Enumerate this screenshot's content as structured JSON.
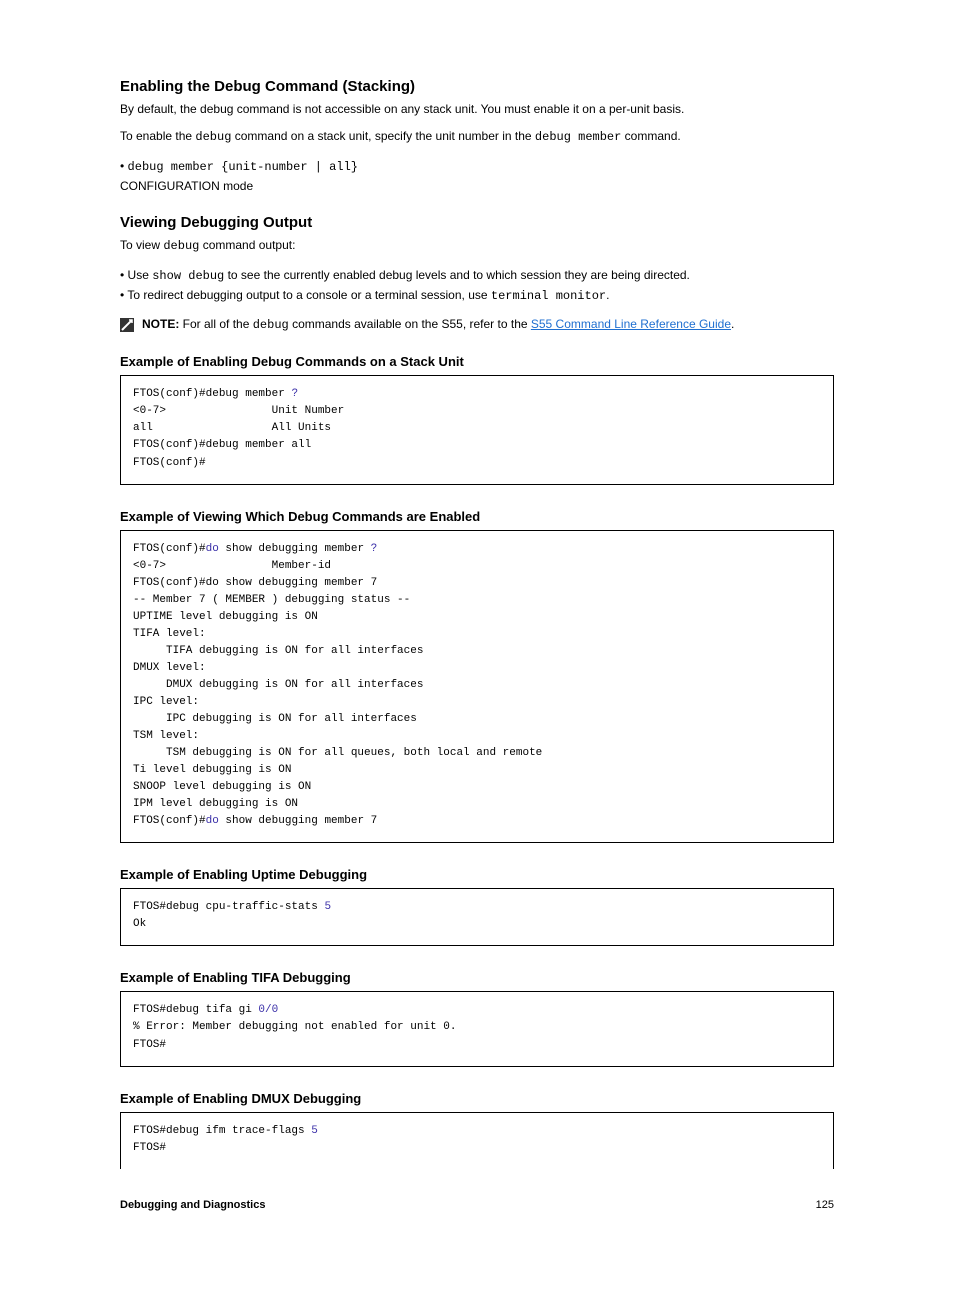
{
  "sections": {
    "enable_title": "Enabling the Debug Command (Stacking)",
    "enable_p1": "By default, the debug command is not accessible on any stack unit. You must enable it on a per-unit basis.",
    "enable_p2_prefix": "To enable the ",
    "enable_p2_code": "debug",
    "enable_p2_middle": " command on a stack unit, specify the unit number in the ",
    "enable_p2_cmd": "debug member",
    "enable_p2_suffix": " command.",
    "enable_li1_cmd": "debug member {unit-number | all}",
    "enable_li1_mode": "CONFIGURATION mode"
  },
  "output": {
    "title": "Viewing Debugging Output",
    "p1_prefix": "To view ",
    "p1_code": "debug",
    "p1_suffix": " command output:",
    "li1_prefix": "Use ",
    "li1_cmd": "show debug",
    "li1_suffix": " to see the currently enabled debug levels and to which session they are being directed.",
    "li2_prefix": "To redirect debugging output to a console or a terminal session, use ",
    "li2_cmd": "terminal monitor",
    "li2_suffix": "."
  },
  "note": {
    "label": "NOTE:",
    "text_prefix": " For all of the ",
    "text_cmd": "debug",
    "text_middle": " commands available on the S55, refer to the ",
    "link_text": "S55 Command Line Reference Guide",
    "text_suffix": "."
  },
  "examples": {
    "ex1": {
      "title": "Example of Enabling Debug Commands on a Stack Unit",
      "line1_a": "FTOS(conf)#debug member ",
      "line1_b": "?",
      "line2": "<0-7>                Unit Number",
      "line3": "all                  All Units",
      "line4": "FTOS(conf)#debug member all",
      "line5": "FTOS(conf)#"
    },
    "ex2": {
      "title": "Example of Viewing Which Debug Commands are Enabled",
      "line1_a": "FTOS(conf)#",
      "line1_b": "do",
      "line1_c": " show debugging member ",
      "line1_d": "?",
      "line2": "<0-7>                Member-id",
      "line3": "FTOS(conf)#do show debugging member 7",
      "line4": "-- Member 7 ( MEMBER ) debugging status --",
      "line5": "UPTIME level debugging is ON",
      "line6": "TIFA level:",
      "line7": "     TIFA debugging is ON for all interfaces",
      "line8": "DMUX level:",
      "line9": "     DMUX debugging is ON for all interfaces",
      "line10": "IPC level:",
      "line11": "     IPC debugging is ON for all interfaces",
      "line12": "TSM level:",
      "line13": "     TSM debugging is ON for all queues, both local and remote",
      "line14": "Ti level debugging is ON",
      "line15": "SNOOP level debugging is ON",
      "line16": "IPM level debugging is ON",
      "line17a": "FTOS(conf)#",
      "line17b": "do",
      "line17c": " show debugging member 7"
    },
    "ex3": {
      "title": "Example of Enabling Uptime Debugging",
      "line1a": "FTOS#debug cpu-traffic-stats ",
      "line1b": "5",
      "line2": "Ok"
    },
    "ex4": {
      "title": "Example of Enabling TIFA Debugging",
      "line1a": "FTOS#debug tifa gi ",
      "line1b": "0/0",
      "line2": "% Error: Member debugging not enabled for unit 0.",
      "line3": "FTOS#"
    },
    "ex5": {
      "title": "Example of Enabling DMUX Debugging",
      "line1a": "FTOS#debug ifm trace-flags ",
      "line1b": "5",
      "line2": "FTOS#"
    }
  },
  "footer": {
    "title": "Debugging and Diagnostics",
    "page": "125"
  }
}
